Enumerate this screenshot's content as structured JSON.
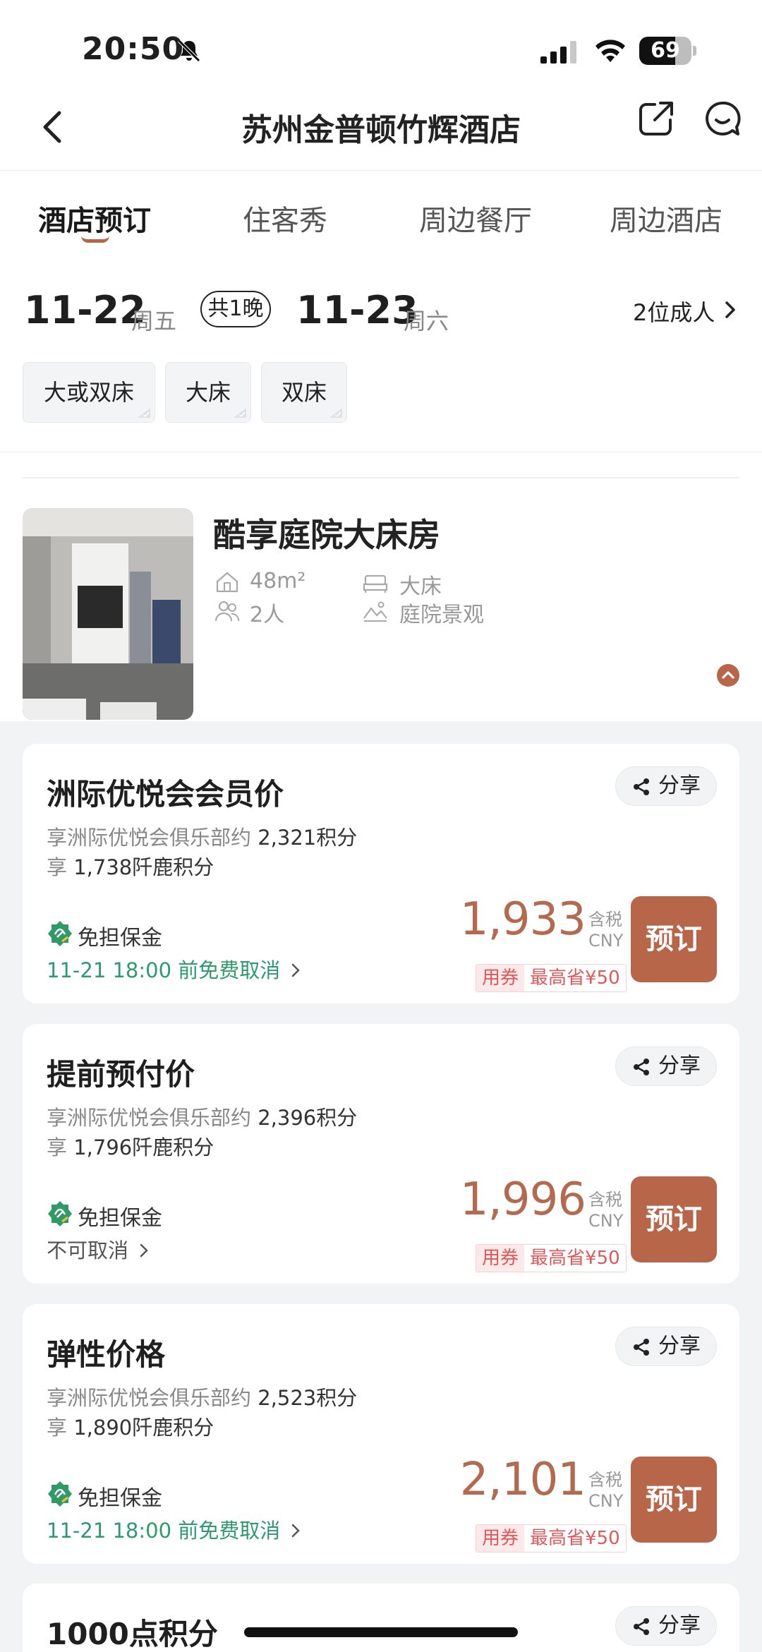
{
  "status_bar": {
    "time": "20:50",
    "battery": "69",
    "battery_level": 0.69
  },
  "nav": {
    "title": "苏州金普顿竹辉酒店"
  },
  "tabs": [
    {
      "label": "酒店预订",
      "active": true
    },
    {
      "label": "住客秀",
      "active": false
    },
    {
      "label": "周边餐厅",
      "active": false
    },
    {
      "label": "周边酒店",
      "active": false
    }
  ],
  "dates": {
    "checkin": "11-22",
    "checkin_week": "周五",
    "nights": "共1晚",
    "checkout": "11-23",
    "checkout_week": "周六",
    "guests": "2位成人"
  },
  "bed_filters": [
    "大或双床",
    "大床",
    "双床"
  ],
  "room": {
    "name": "酷享庭院大床房",
    "area": "48m²",
    "bed": "大床",
    "occupancy": "2人",
    "view": "庭院景观"
  },
  "rate_cards": [
    {
      "title": "洲际优悦会会员价",
      "share": "分享",
      "club_prefix": "享洲际优悦会俱乐部约",
      "club_points": "2,321积分",
      "deer_prefix": "享",
      "deer_points": "1,738阡鹿积分",
      "deposit": "免担保金",
      "cancel": "11-21 18:00 前免费取消",
      "price": "1,933",
      "tax_label": "含税",
      "currency": "CNY",
      "coupon_tag": "用券",
      "coupon_save": "最高省¥50",
      "book": "预订"
    },
    {
      "title": "提前预付价",
      "share": "分享",
      "club_prefix": "享洲际优悦会俱乐部约",
      "club_points": "2,396积分",
      "deer_prefix": "享",
      "deer_points": "1,796阡鹿积分",
      "deposit": "免担保金",
      "cancel": "不可取消",
      "price": "1,996",
      "tax_label": "含税",
      "currency": "CNY",
      "coupon_tag": "用券",
      "coupon_save": "最高省¥50",
      "book": "预订"
    },
    {
      "title": "弹性价格",
      "share": "分享",
      "club_prefix": "享洲际优悦会俱乐部约",
      "club_points": "2,523积分",
      "deer_prefix": "享",
      "deer_points": "1,890阡鹿积分",
      "deposit": "免担保金",
      "cancel": "11-21 18:00 前免费取消",
      "price": "2,101",
      "tax_label": "含税",
      "currency": "CNY",
      "coupon_tag": "用券",
      "coupon_save": "最高省¥50",
      "book": "预订"
    }
  ],
  "next_card": {
    "title": "1000点积分",
    "share": "分享"
  },
  "colors": {
    "accent": "#b8664a",
    "price": "#b46a4e",
    "green": "#2e9b6e",
    "coupon_red": "#e0595a"
  }
}
